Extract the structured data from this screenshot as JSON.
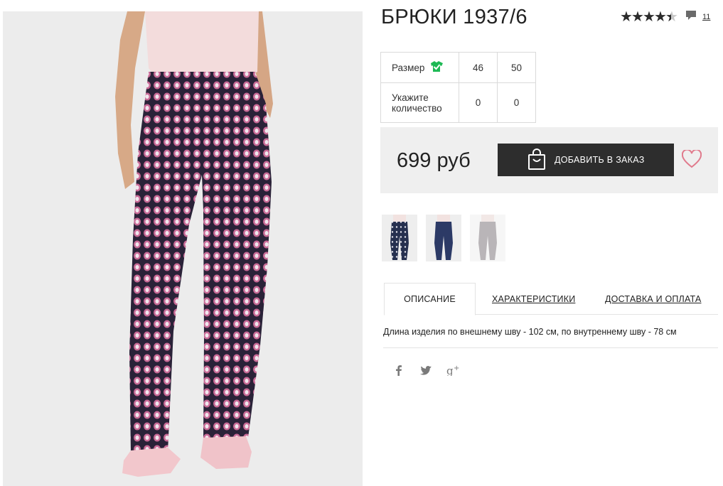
{
  "product": {
    "title": "БРЮКИ 1937/6",
    "rating": 4.5,
    "reviews_count": "11",
    "price": "699 руб",
    "add_to_cart": "ДОБАВИТЬ В ЗАКАЗ"
  },
  "size_table": {
    "size_label": "Размер",
    "quantity_label": "Укажите количество",
    "sizes": [
      "46",
      "50"
    ],
    "quantities": [
      "0",
      "0"
    ]
  },
  "tabs": {
    "description": "ОПИСАНИЕ",
    "characteristics": "ХАРАКТЕРИСТИКИ",
    "delivery": "ДОСТАВКА И ОПЛАТА"
  },
  "description_text": "Длина изделия по внешнему шву - 102 см, по внутреннему шву - 78 см",
  "icons": {
    "rating": "star-icon",
    "reviews": "comment-icon",
    "size_guide": "shirt-check-icon",
    "cart": "shopping-bag-icon",
    "wishlist": "heart-icon",
    "social": [
      "facebook-icon",
      "twitter-icon",
      "google-plus-icon"
    ]
  },
  "colors": {
    "button_bg": "#2d2d2d",
    "heart": "#e07a8c",
    "size_guide_icon": "#1db954",
    "panel_bg": "#efefef"
  }
}
